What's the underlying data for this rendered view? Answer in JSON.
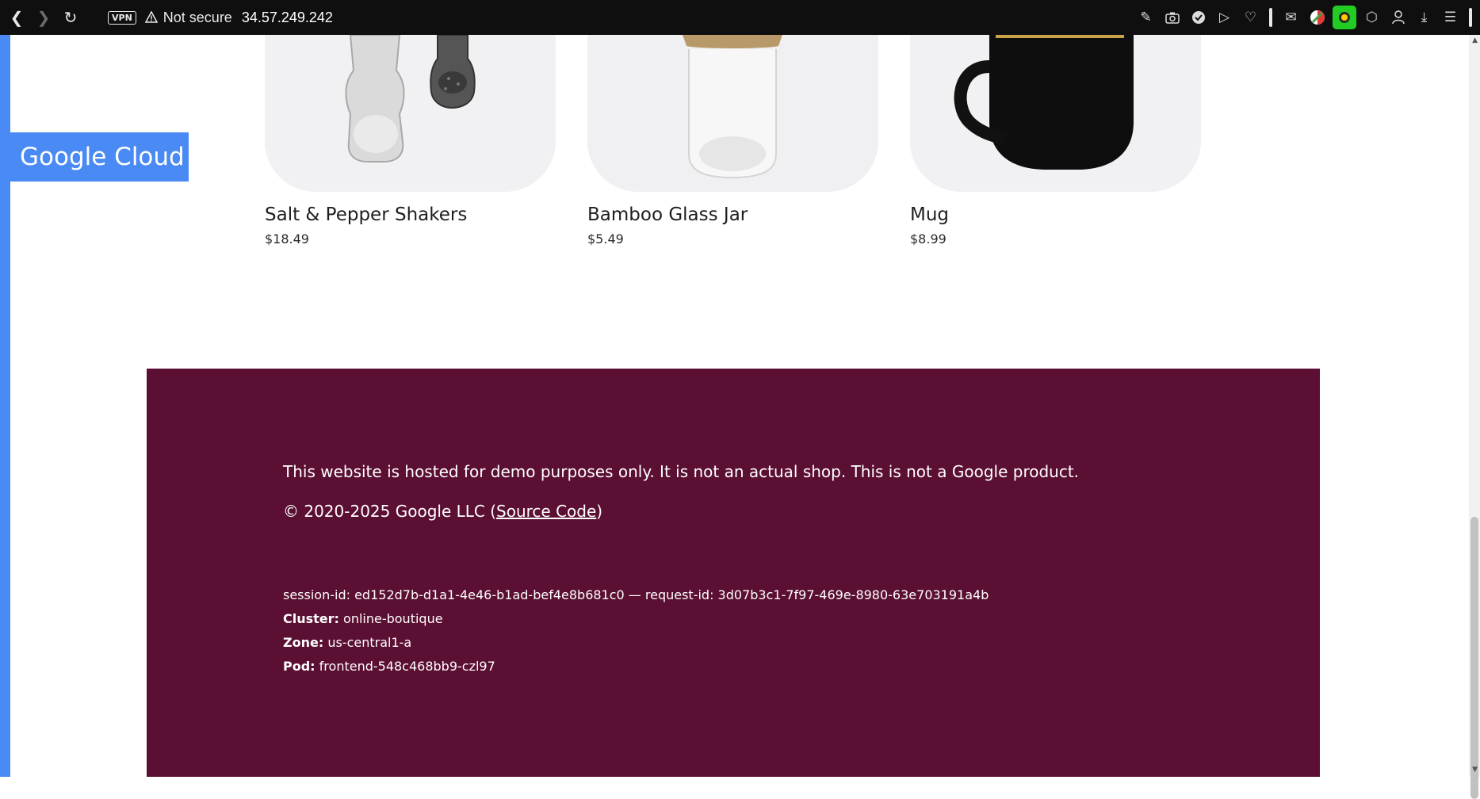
{
  "browser": {
    "vpn_label": "VPN",
    "security_label": "Not secure",
    "address": "34.57.249.242"
  },
  "banner": {
    "label": "Google Cloud"
  },
  "products": [
    {
      "name": "Salt & Pepper Shakers",
      "price": "$18.49"
    },
    {
      "name": "Bamboo Glass Jar",
      "price": "$5.49"
    },
    {
      "name": "Mug",
      "price": "$8.99"
    }
  ],
  "footer": {
    "disclaimer": "This website is hosted for demo purposes only. It is not an actual shop. This is not a Google product.",
    "copyright_prefix": "© 2020-2025 Google LLC (",
    "source_link": "Source Code",
    "copyright_suffix": ")",
    "session_line": "session-id: ed152d7b-d1a1-4e46-b1ad-bef4e8b681c0 — request-id: 3d07b3c1-7f97-469e-8980-63e703191a4b",
    "cluster_label": "Cluster:",
    "cluster_value": " online-boutique",
    "zone_label": "Zone:",
    "zone_value": " us-central1-a",
    "pod_label": "Pod:",
    "pod_value": " frontend-548c468bb9-czl97"
  },
  "colors": {
    "accent_blue": "#4a8af4",
    "footer_bg": "#5b0f32",
    "browser_bar": "#0f0f0f"
  }
}
